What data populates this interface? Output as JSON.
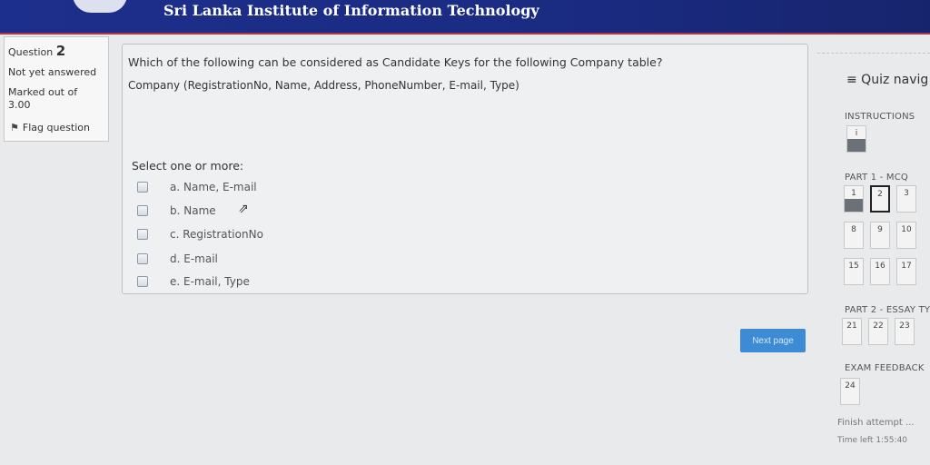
{
  "header": {
    "title": "Sri Lanka Institute of Information Technology"
  },
  "question_info": {
    "question_label": "Question",
    "question_number": "2",
    "state": "Not yet answered",
    "marked_out_of": "Marked out of",
    "max_mark": "3.00",
    "flag_label": "Flag question"
  },
  "question": {
    "text": "Which of the following can be considered as Candidate Keys for the following Company table?",
    "schema": "Company (RegistrationNo, Name, Address, PhoneNumber, E-mail, Type)",
    "prompt": "Select one or more:",
    "options": [
      {
        "label": "a. Name, E-mail"
      },
      {
        "label": "b. Name"
      },
      {
        "label": "c. RegistrationNo"
      },
      {
        "label": "d. E-mail"
      },
      {
        "label": "e. E-mail, Type"
      }
    ]
  },
  "next_button": "Next page",
  "quiz_nav": {
    "title": "≡ Quiz navig",
    "sections": [
      {
        "name": "INSTRUCTIONS",
        "items": [
          "i"
        ]
      },
      {
        "name": "PART 1 - MCQ",
        "items": [
          "1",
          "2",
          "3",
          "8",
          "9",
          "10",
          "15",
          "16",
          "17"
        ]
      },
      {
        "name": "PART 2 - ESSAY TYP",
        "items": [
          "21",
          "22",
          "23"
        ]
      },
      {
        "name": "EXAM FEEDBACK",
        "items": [
          "24"
        ]
      }
    ],
    "finish": "Finish attempt ...",
    "time_left": "Time left 1:55:40"
  },
  "colors": {
    "header": "#1d2f8c",
    "accent_line": "#b83245",
    "button": "#3d8bd4"
  }
}
